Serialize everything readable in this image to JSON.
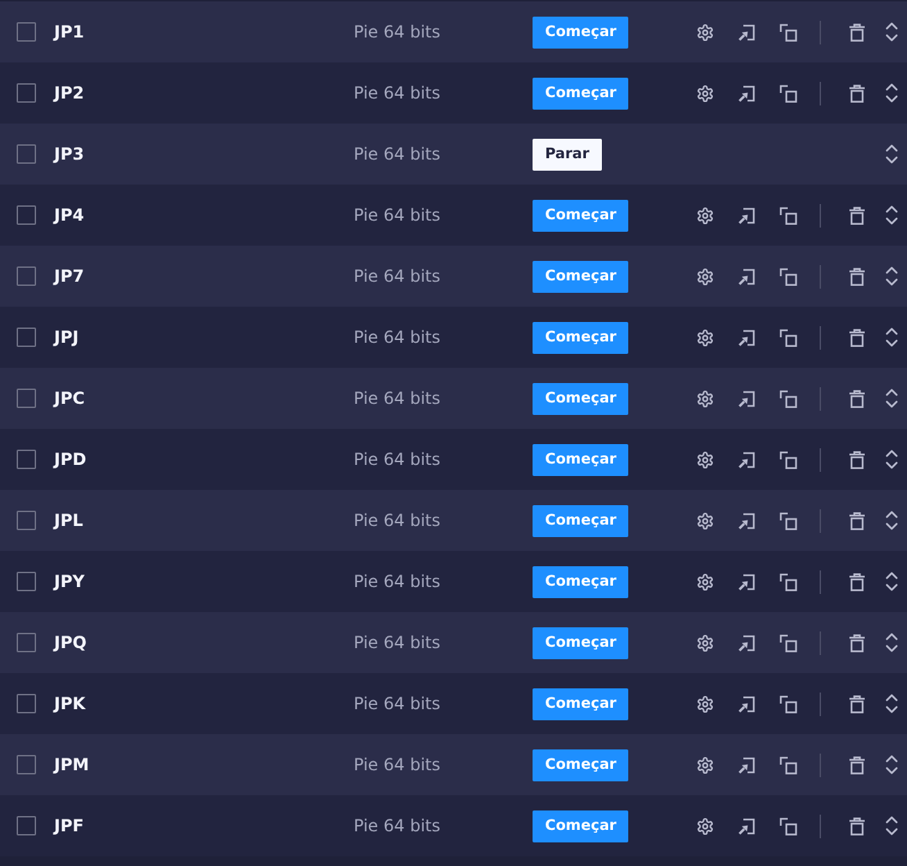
{
  "rows": [
    {
      "name": "JP1",
      "mode": "Pie 64 bits",
      "action": "Começar",
      "running": false,
      "checked": false
    },
    {
      "name": "JP2",
      "mode": "Pie 64 bits",
      "action": "Começar",
      "running": false,
      "checked": false
    },
    {
      "name": "JP3",
      "mode": "Pie 64 bits",
      "action": "Parar",
      "running": true,
      "checked": false
    },
    {
      "name": "JP4",
      "mode": "Pie 64 bits",
      "action": "Começar",
      "running": false,
      "checked": false
    },
    {
      "name": "JP7",
      "mode": "Pie 64 bits",
      "action": "Começar",
      "running": false,
      "checked": false
    },
    {
      "name": "JPJ",
      "mode": "Pie 64 bits",
      "action": "Começar",
      "running": false,
      "checked": false
    },
    {
      "name": "JPC",
      "mode": "Pie 64 bits",
      "action": "Começar",
      "running": false,
      "checked": false
    },
    {
      "name": "JPD",
      "mode": "Pie 64 bits",
      "action": "Começar",
      "running": false,
      "checked": false
    },
    {
      "name": "JPL",
      "mode": "Pie 64 bits",
      "action": "Começar",
      "running": false,
      "checked": false
    },
    {
      "name": "JPY",
      "mode": "Pie 64 bits",
      "action": "Começar",
      "running": false,
      "checked": false
    },
    {
      "name": "JPQ",
      "mode": "Pie 64 bits",
      "action": "Começar",
      "running": false,
      "checked": false
    },
    {
      "name": "JPK",
      "mode": "Pie 64 bits",
      "action": "Começar",
      "running": false,
      "checked": false
    },
    {
      "name": "JPM",
      "mode": "Pie 64 bits",
      "action": "Começar",
      "running": false,
      "checked": false
    },
    {
      "name": "JPF",
      "mode": "Pie 64 bits",
      "action": "Começar",
      "running": false,
      "checked": false
    }
  ]
}
